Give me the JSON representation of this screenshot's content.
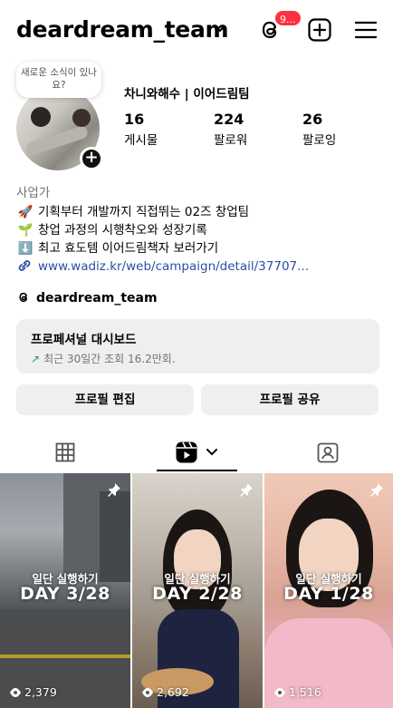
{
  "header": {
    "username": "deardream_team",
    "notification_count": "9..."
  },
  "profile": {
    "bubble_text": "새로운 소식이 있나요?",
    "display_name": "차니와해수 | 이어드림팀",
    "stats": [
      {
        "value": "16",
        "label": "게시물"
      },
      {
        "value": "224",
        "label": "팔로워"
      },
      {
        "value": "26",
        "label": "팔로잉"
      }
    ],
    "category": "사업가",
    "bio": [
      {
        "icon": "rocket",
        "emoji": "🚀",
        "text": "기획부터 개발까지 직접뛰는 02즈 창업팀"
      },
      {
        "icon": "seedling",
        "emoji": "🌱",
        "text": "창업 과정의 시행착오와 성장기록"
      },
      {
        "icon": "down-arrow",
        "emoji": "⬇️",
        "text": "최고 효도템 이어드림책자 보러가기"
      }
    ],
    "link": "www.wadiz.kr/web/campaign/detail/37707...",
    "threads_handle": "deardream_team"
  },
  "dashboard": {
    "title": "프로페셔널 대시보드",
    "subtitle": "최근 30일간 조회 16.2만회."
  },
  "buttons": {
    "edit": "프로필 편집",
    "share": "프로필 공유"
  },
  "tabs": [
    {
      "name": "grid",
      "active": false
    },
    {
      "name": "reels",
      "active": true
    },
    {
      "name": "tagged",
      "active": false
    }
  ],
  "grid": [
    {
      "line1": "일단 실행하기",
      "line2": "DAY 3/28",
      "views": "2,379",
      "pinned": true
    },
    {
      "line1": "일단 실행하기",
      "line2": "DAY 2/28",
      "views": "2,692",
      "pinned": true
    },
    {
      "line1": "일단 실행하기",
      "line2": "DAY 1/28",
      "views": "1,516",
      "pinned": true
    }
  ],
  "colors": {
    "badge": "#ff3040",
    "link": "#2b4fa6",
    "trend_up": "#1d9e55",
    "button_bg": "#efefef"
  }
}
